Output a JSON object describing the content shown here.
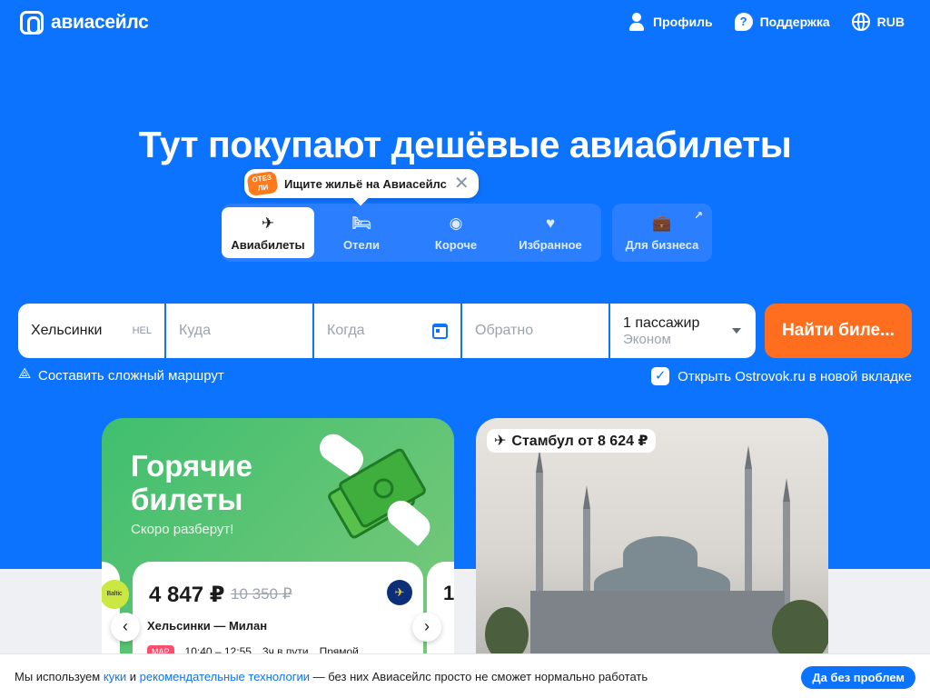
{
  "header": {
    "logo_text": "авиасейлс",
    "nav": [
      {
        "label": "Профиль",
        "icon": "user-icon"
      },
      {
        "label": "Поддержка",
        "icon": "help-icon",
        "glyph": "?"
      },
      {
        "label": "RUB",
        "icon": "globe-icon"
      }
    ]
  },
  "hero": {
    "title": "Тут покупают дешёвые авиабилеты",
    "promo_badge": "ОТЕЗ ЛИ",
    "promo_text": "Ищите жильё на Авиасейлс",
    "promo_close": "✕"
  },
  "tabs": [
    {
      "label": "Авиабилеты",
      "glyph": "✈",
      "active": true
    },
    {
      "label": "Отели",
      "glyph": "🛏"
    },
    {
      "label": "Короче",
      "glyph": "◉"
    },
    {
      "label": "Избранное",
      "glyph": "♥"
    }
  ],
  "business_tab": {
    "label": "Для бизнеса",
    "glyph": "💼",
    "arrow": "↗"
  },
  "search": {
    "from_value": "Хельсинки",
    "from_code": "HEL",
    "to_placeholder": "Куда",
    "date_placeholder": "Когда",
    "return_placeholder": "Обратно",
    "passengers": "1 пассажир",
    "cabin_class": "Эконом",
    "button_label": "Найти биле..."
  },
  "route_link": "Составить сложный маршрут",
  "ostrovok": {
    "label": "Открыть Ostrovok.ru в новой вкладке",
    "checked": true,
    "check_glyph": "✓"
  },
  "hot_tickets": {
    "title_line1": "Горячие",
    "title_line2": "билеты",
    "subtitle": "Скоро разберут!",
    "left_airline": "Baltic",
    "ticket": {
      "price": "4 847 ₽",
      "old_price": "10 350 ₽",
      "airline_glyph": "✈",
      "route": "Хельсинки — Милан",
      "month": "МАР",
      "time": "10:40 – 12:55",
      "duration": "3ч в пути",
      "stops": "Прямой"
    },
    "next_peek": "1",
    "prev_glyph": "‹",
    "next_glyph": "›"
  },
  "istanbul": {
    "glyph": "✈",
    "label": "Стамбул от 8 624 ₽"
  },
  "cookie": {
    "text_start": "Мы используем",
    "link_cookies": "куки",
    "and": "и",
    "link_tech": "рекомендательные технологии",
    "text_end": "— без них Авиасейлс просто не сможет нормально работать",
    "button": "Да без проблем"
  },
  "colors": {
    "brand_blue": "#0c73fe",
    "search_orange": "#ff6d1f",
    "hot_green": "#3fbf6f"
  }
}
